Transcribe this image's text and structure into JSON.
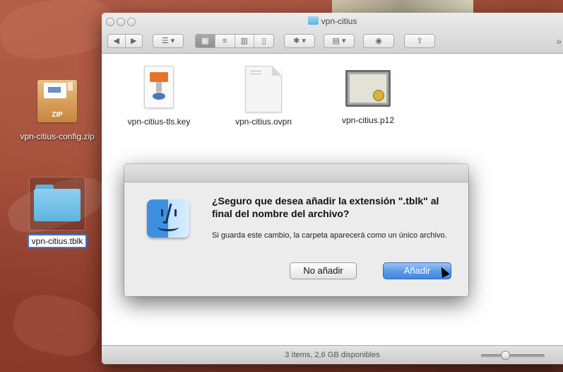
{
  "desktop": {
    "items": [
      {
        "label": "vpn-citius-config.zip",
        "icon": "zip-archive-icon",
        "badge": "ZIP"
      },
      {
        "label": "vpn-citius.tblk",
        "icon": "folder-icon"
      }
    ]
  },
  "finder": {
    "title": "vpn-citius",
    "toolbar": {
      "back": "◀",
      "forward": "▶",
      "more": "»"
    },
    "files": [
      {
        "name": "vpn-citius-tls.key",
        "icon": "keynote-document-icon"
      },
      {
        "name": "vpn-citius.ovpn",
        "icon": "blank-document-icon"
      },
      {
        "name": "vpn-citius.p12",
        "icon": "certificate-icon"
      }
    ],
    "status": "3 ítems, 2,6 GB disponibles"
  },
  "dialog": {
    "title": "¿Seguro que desea añadir la extensión \".tblk\" al final del nombre del archivo?",
    "message": "Si guarda este cambio, la carpeta aparecerá como un único archivo.",
    "cancel_label": "No añadir",
    "confirm_label": "Añadir"
  },
  "colors": {
    "accent": "#3f86e2",
    "selection": "#3c78d8"
  }
}
